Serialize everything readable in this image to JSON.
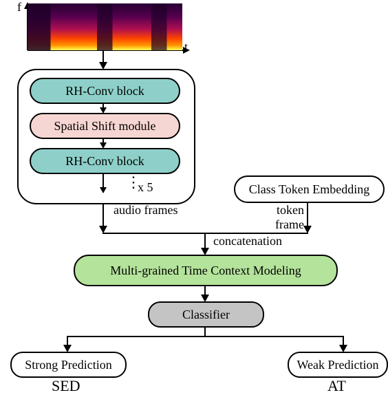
{
  "axis": {
    "f": "f",
    "t": "t"
  },
  "blocks": {
    "rh1": "RH-Conv block",
    "shift": "Spatial Shift module",
    "rh2": "RH-Conv block",
    "repeat": "x 5",
    "classtok": "Class Token Embedding",
    "mgtcm": "Multi-grained Time Context Modeling",
    "classifier": "Classifier",
    "strong": "Strong Prediction",
    "weak": "Weak Prediction"
  },
  "labels": {
    "audio_frames": "audio frames",
    "token_frame": "token frame",
    "concat": "concatenation",
    "sed": "SED",
    "at": "AT"
  },
  "dots": "⋮"
}
